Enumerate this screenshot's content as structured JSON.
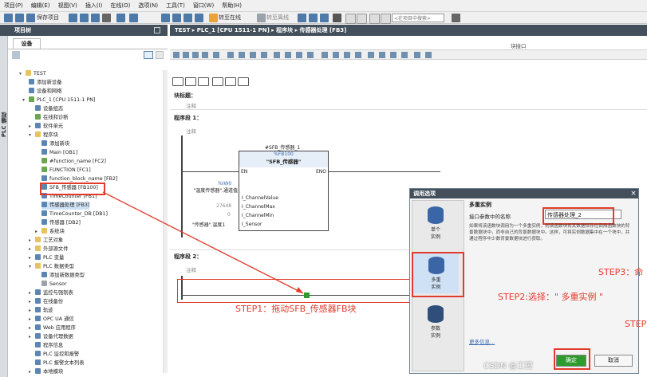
{
  "menu": [
    "项目(P)",
    "编辑(E)",
    "视图(V)",
    "插入(I)",
    "在线(O)",
    "选项(N)",
    "工具(T)",
    "窗口(W)",
    "帮助(H)"
  ],
  "toolbar": {
    "save_project": "保存项目",
    "go_online": "转至在线",
    "go_offline": "转至离线",
    "search_placeholder": "<在项目中搜索>"
  },
  "project_tree": {
    "header": "项目树",
    "tab": "设备",
    "side_tab": "PLC 编程",
    "items": [
      {
        "label": "TEST"
      },
      {
        "label": "添加新设备"
      },
      {
        "label": "设备和网络"
      },
      {
        "label": "PLC_1 [CPU 1511-1 PN]"
      },
      {
        "label": "设备组态"
      },
      {
        "label": "在线和诊断"
      },
      {
        "label": "软件单元"
      },
      {
        "label": "程序块"
      },
      {
        "label": "添加新块"
      },
      {
        "label": "Main [OB1]"
      },
      {
        "label": "#function_name [FC2]"
      },
      {
        "label": "FUNCTION [FC1]"
      },
      {
        "label": "function_block_name [FB2]"
      },
      {
        "label": "SFB_传感器 [FB100]"
      },
      {
        "label": "TimeCounter [FB1]"
      },
      {
        "label": "传感器处理 [FB3]"
      },
      {
        "label": "TimeCounter_DB [DB1]"
      },
      {
        "label": "传感器 [DB2]"
      },
      {
        "label": "系统块"
      },
      {
        "label": "工艺对象"
      },
      {
        "label": "外部源文件"
      },
      {
        "label": "PLC 变量"
      },
      {
        "label": "PLC 数据类型"
      },
      {
        "label": "添加新数据类型"
      },
      {
        "label": "Sensor"
      },
      {
        "label": "监控与强制表"
      },
      {
        "label": "在线备份"
      },
      {
        "label": "轨迹"
      },
      {
        "label": "OPC UA 通信"
      },
      {
        "label": "Web 应用程序"
      },
      {
        "label": "设备代理数据"
      },
      {
        "label": "程序信息"
      },
      {
        "label": "PLC 监控和报警"
      },
      {
        "label": "PLC 报警文本列表"
      },
      {
        "label": "本地模块"
      }
    ]
  },
  "editor": {
    "breadcrumb": "TEST ▸ PLC_1 [CPU 1511-1 PN] ▸ 程序块 ▸ 传感器处理 [FB3]",
    "block_interface": "块接口",
    "block_title": "块标题：",
    "comment": "注释",
    "network1": "程序段 1：",
    "network2": "程序段 2：",
    "instance_name": "#SFB_传感器_1",
    "fb_number": "%FB100",
    "fb_name": "\"SFB_传感器\"",
    "en": "EN",
    "eno": "ENO",
    "input_address": "%IW0",
    "input_tag": "\"温度传感器\".通道值",
    "pins": [
      "I_ChannelValue",
      "I_ChannelMax",
      "I_ChannelMin",
      "I_Sensor"
    ],
    "max_value": "27648",
    "min_value": "0",
    "sensor_value": "\"传感器\".温度1"
  },
  "dialog": {
    "title": "调用选项",
    "section": "多重实例",
    "param_label": "接口参数中的名称",
    "param_value": "传感器处理_2",
    "description": "如果将该函数块调用为一个多重实例，则该函数块将其数据保存在调用函数块的背景数据块中，而非自己的背景数据块中。这样，可将实例数据集中在一个块中，并通过程序中少数背景数据块进行获取。",
    "options": [
      {
        "label": "单个\n实例"
      },
      {
        "label": "多重\n实例"
      },
      {
        "label": "参数\n实例"
      }
    ],
    "more_info": "更多信息...",
    "ok": "确定",
    "cancel": "取消"
  },
  "annotations": {
    "step1": "STEP1：拖动SFB_传感器FB块",
    "step2": "STEP2:选择：\" 多重实例 \"",
    "step3": "STEP3：命",
    "step4": "STEP"
  },
  "watermark": "CSDN @工控"
}
